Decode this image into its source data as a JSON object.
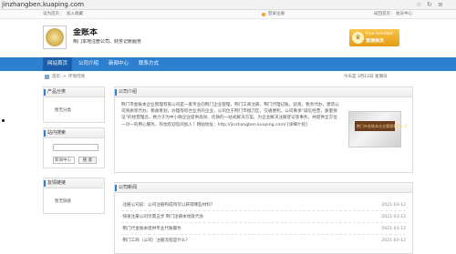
{
  "browser": {
    "url": "jinzhangben.kuaping.com"
  },
  "topbar": {
    "left": [
      "设为首页",
      "加入收藏"
    ],
    "right_login": "登录注册",
    "right_links": [
      "返回首页",
      "会员中心"
    ]
  },
  "header": {
    "company": "金账本",
    "slogan": "荆门本地注册公司、财务记账服务",
    "vip_line1": "Free member",
    "vip_line2": "普通会员"
  },
  "nav": [
    "网站首页",
    "公司介绍",
    "新闻中心",
    "联系方式"
  ],
  "breadcrumb": {
    "home": "首页",
    "current": "环境内场"
  },
  "date_text": "今天是 3月12日 星期日",
  "sidebar": {
    "products_title": "产品分类",
    "products_empty": "暂无分类",
    "search_title": "站内搜索",
    "search_select": "新闻中心",
    "search_button": "搜 索",
    "links_title": "友情链接",
    "links_empty": "暂无链接"
  },
  "intro": {
    "title": "公司介绍",
    "text": "荆门市金账本企业管理有限公司是一家专业的荆门企业管理，荆门工商注册，荆门代理记账，验资，税务代办，建筑公司资质等代办，税收筹划，办理等综合业务的企业，公司位于荆门市掇刀区，交通便利。公司秉承“诚信经营，质量保证”的经营理念，致力于为中小微企业提供高效、优质的一站式解决方案，为企业解决注册登记等事务，并提供全方位一对一的用心服务，热忱欢迎您的加入！网站地址：http://jinzhangben.kuaping.com/ [详细介绍]",
    "image_text": "荆门市金账本企业管理有限公司"
  },
  "news": {
    "title": "公司新闻",
    "items": [
      {
        "title": "·注册公司前：公司注册构成和可以获得哪些材料？",
        "date": "2021-03-12"
      },
      {
        "title": "·快速注册公司仅需五步 荆门注册本地就代办",
        "date": "2021-03-12"
      },
      {
        "title": "·荆门代金账本提供专业代账服务",
        "date": "2021-03-12"
      },
      {
        "title": "·荆门工商（公司）注册流程是什么？",
        "date": "2021-03-12"
      }
    ]
  },
  "colors": {
    "nav": "#2f7fd0",
    "nav_active": "#1a5fab",
    "vip": "#f2b22c"
  }
}
